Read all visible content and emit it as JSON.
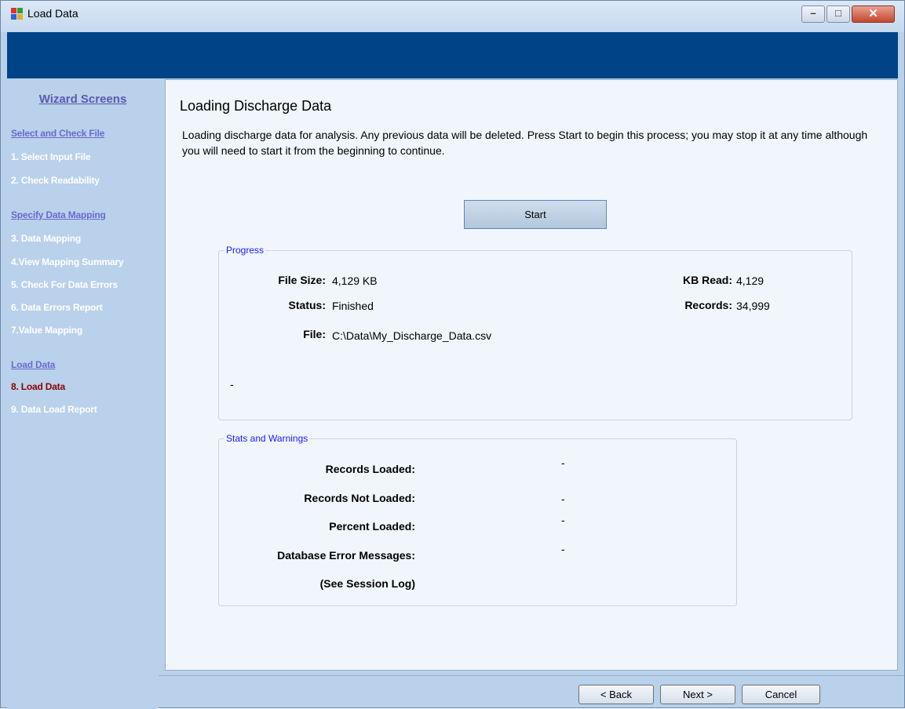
{
  "window": {
    "title": "Load Data",
    "buttons": {
      "minimize": "–",
      "maximize": "□",
      "close": "✕"
    }
  },
  "sidebar": {
    "title": "Wizard Screens",
    "items": [
      {
        "label": "Select and Check File",
        "kind": "group"
      },
      {
        "label": "1. Select Input File",
        "kind": "step",
        "state": "done"
      },
      {
        "label": "2. Check Readability",
        "kind": "step",
        "state": "done"
      },
      {
        "label": "Specify Data Mapping",
        "kind": "group"
      },
      {
        "label": "3. Data Mapping",
        "kind": "step",
        "state": "done"
      },
      {
        "label": "4.View Mapping Summary",
        "kind": "step",
        "state": "done"
      },
      {
        "label": "5. Check For Data Errors",
        "kind": "step",
        "state": "done"
      },
      {
        "label": "6. Data Errors Report",
        "kind": "step",
        "state": "done"
      },
      {
        "label": "7.Value Mapping",
        "kind": "step",
        "state": "done"
      },
      {
        "label": "Load Data",
        "kind": "group"
      },
      {
        "label": "8. Load Data",
        "kind": "step",
        "state": "current"
      },
      {
        "label": "9. Data Load Report",
        "kind": "step",
        "state": "pending"
      }
    ]
  },
  "main": {
    "title": "Loading Discharge Data",
    "description": "Loading discharge data for analysis. Any previous data will be deleted. Press Start to begin this process; you may stop it at any time although you will need to start it from the beginning to continue.",
    "start_label": "Start",
    "progress": {
      "legend": "Progress",
      "file_size_label": "File Size:",
      "file_size_value": "4,129 KB",
      "status_label": "Status:",
      "status_value": "Finished",
      "file_label": "File:",
      "file_value": "C:\\Data\\My_Discharge_Data.csv",
      "kb_read_label": "KB Read:",
      "kb_read_value": "4,129",
      "records_label": "Records:",
      "records_value": "34,999",
      "message": "-"
    },
    "stats": {
      "legend": "Stats and Warnings",
      "rows": [
        {
          "label": "Records Loaded:",
          "value": "-"
        },
        {
          "label": "Records Not Loaded:",
          "value": "-"
        },
        {
          "label": "Percent Loaded:",
          "value": "-"
        },
        {
          "label": "Database Error Messages:",
          "value": "-"
        }
      ],
      "note": "(See Session Log)"
    }
  },
  "footer": {
    "back_label": "< Back",
    "next_label": "Next >",
    "cancel_label": "Cancel"
  },
  "colors": {
    "banner": "#004488",
    "frame": "#b9d1ea",
    "current_step": "#8b0000",
    "group_link": "#6a6ad0",
    "legend": "#1a1aff"
  }
}
